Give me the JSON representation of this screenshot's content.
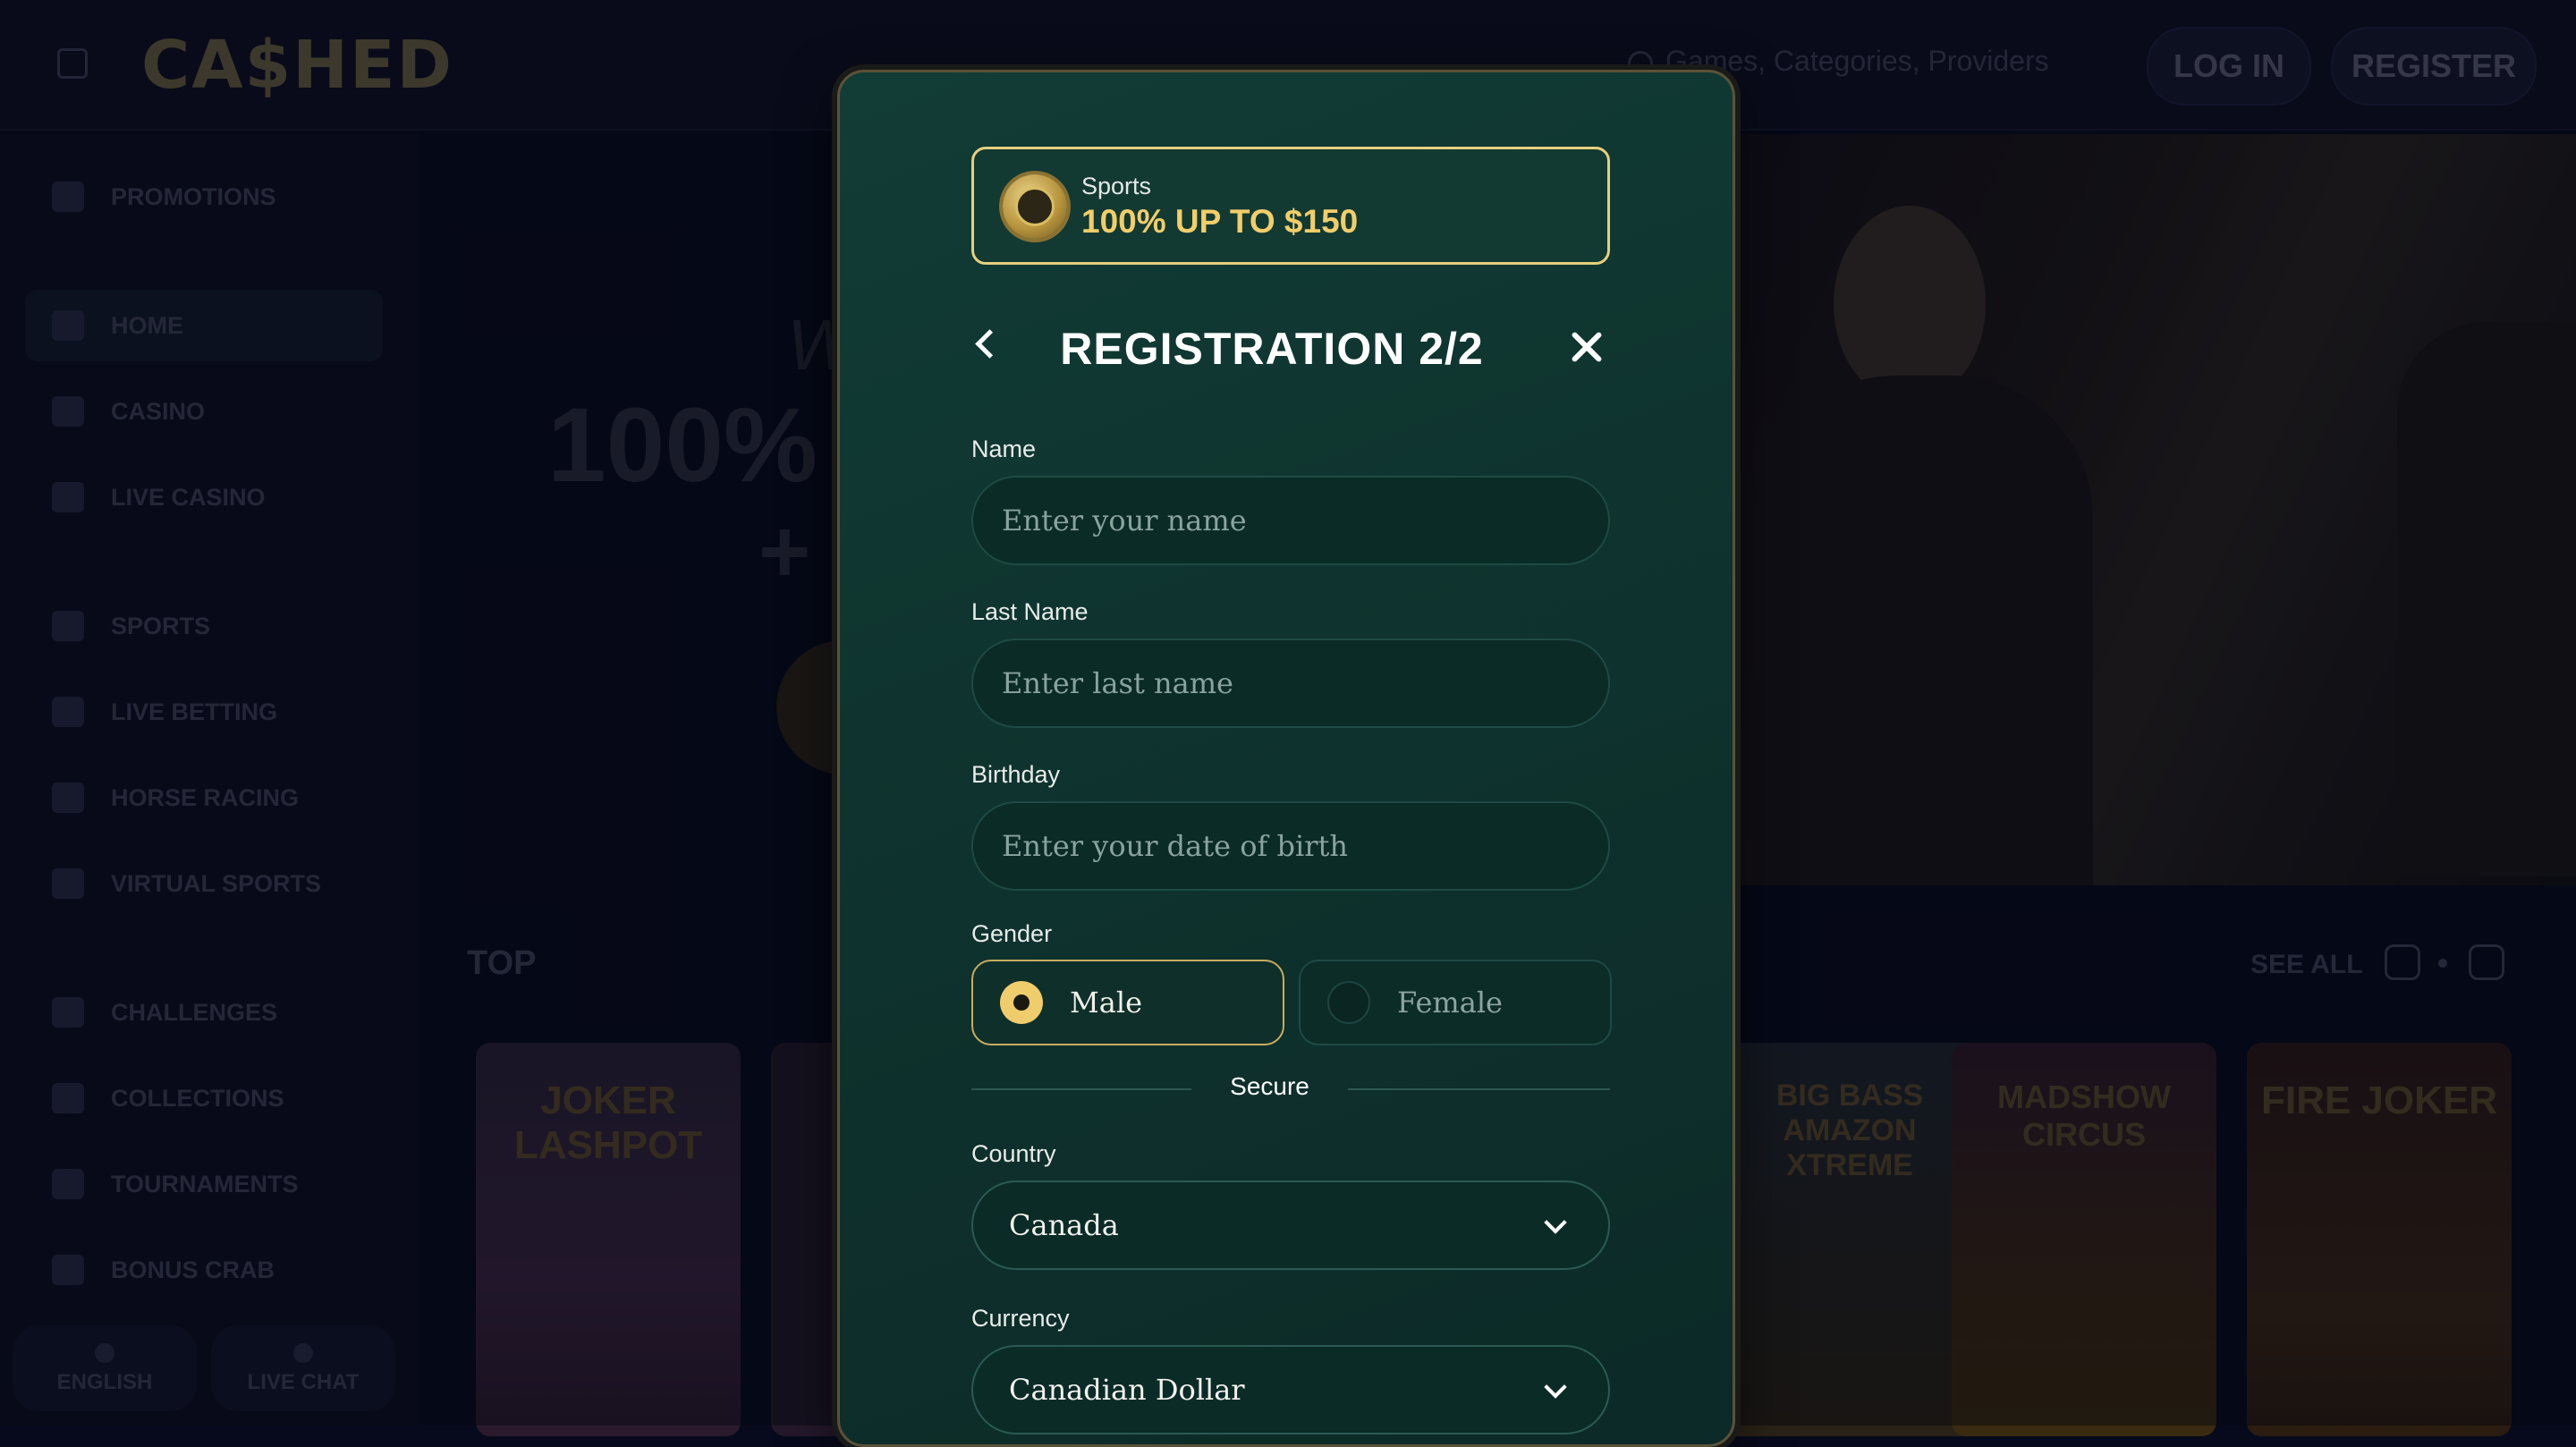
{
  "header": {
    "logo": "CA$HED",
    "search_placeholder": "Games, Categories, Providers",
    "login_label": "LOG IN",
    "register_label": "REGISTER"
  },
  "sidebar": {
    "items": [
      {
        "label": "PROMOTIONS"
      },
      {
        "label": "HOME"
      },
      {
        "label": "CASINO"
      },
      {
        "label": "LIVE CASINO"
      },
      {
        "label": "SPORTS"
      },
      {
        "label": "LIVE BETTING"
      },
      {
        "label": "HORSE RACING"
      },
      {
        "label": "VIRTUAL SPORTS"
      },
      {
        "label": "CHALLENGES"
      },
      {
        "label": "COLLECTIONS"
      },
      {
        "label": "TOURNAMENTS"
      },
      {
        "label": "BONUS CRAB"
      }
    ],
    "language_label": "ENGLISH",
    "live_chat_label": "LIVE CHAT"
  },
  "hero": {
    "headline": "100%",
    "plus": "+"
  },
  "games_section": {
    "title": "TOP",
    "see_all": "SEE ALL",
    "games": [
      "JOKER LASHPOT",
      "BIG BASS AMAZON XTREME",
      "MADSHOW CIRCUS",
      "FIRE JOKER"
    ]
  },
  "modal": {
    "promo": {
      "category": "Sports",
      "offer": "100% UP TO $150"
    },
    "title": "REGISTRATION 2/2",
    "name": {
      "label": "Name",
      "placeholder": "Enter your name",
      "value": ""
    },
    "last_name": {
      "label": "Last Name",
      "placeholder": "Enter last name",
      "value": ""
    },
    "birthday": {
      "label": "Birthday",
      "placeholder": "Enter your date of birth",
      "value": ""
    },
    "gender": {
      "label": "Gender",
      "options": [
        "Male",
        "Female"
      ],
      "selected": "Male"
    },
    "secure_label": "Secure",
    "country": {
      "label": "Country",
      "value": "Canada"
    },
    "currency": {
      "label": "Currency",
      "value": "Canadian Dollar"
    }
  },
  "colors": {
    "accent_gold": "#f0cd6c",
    "modal_bg": "#0f342f",
    "page_bg": "#070a1c"
  }
}
